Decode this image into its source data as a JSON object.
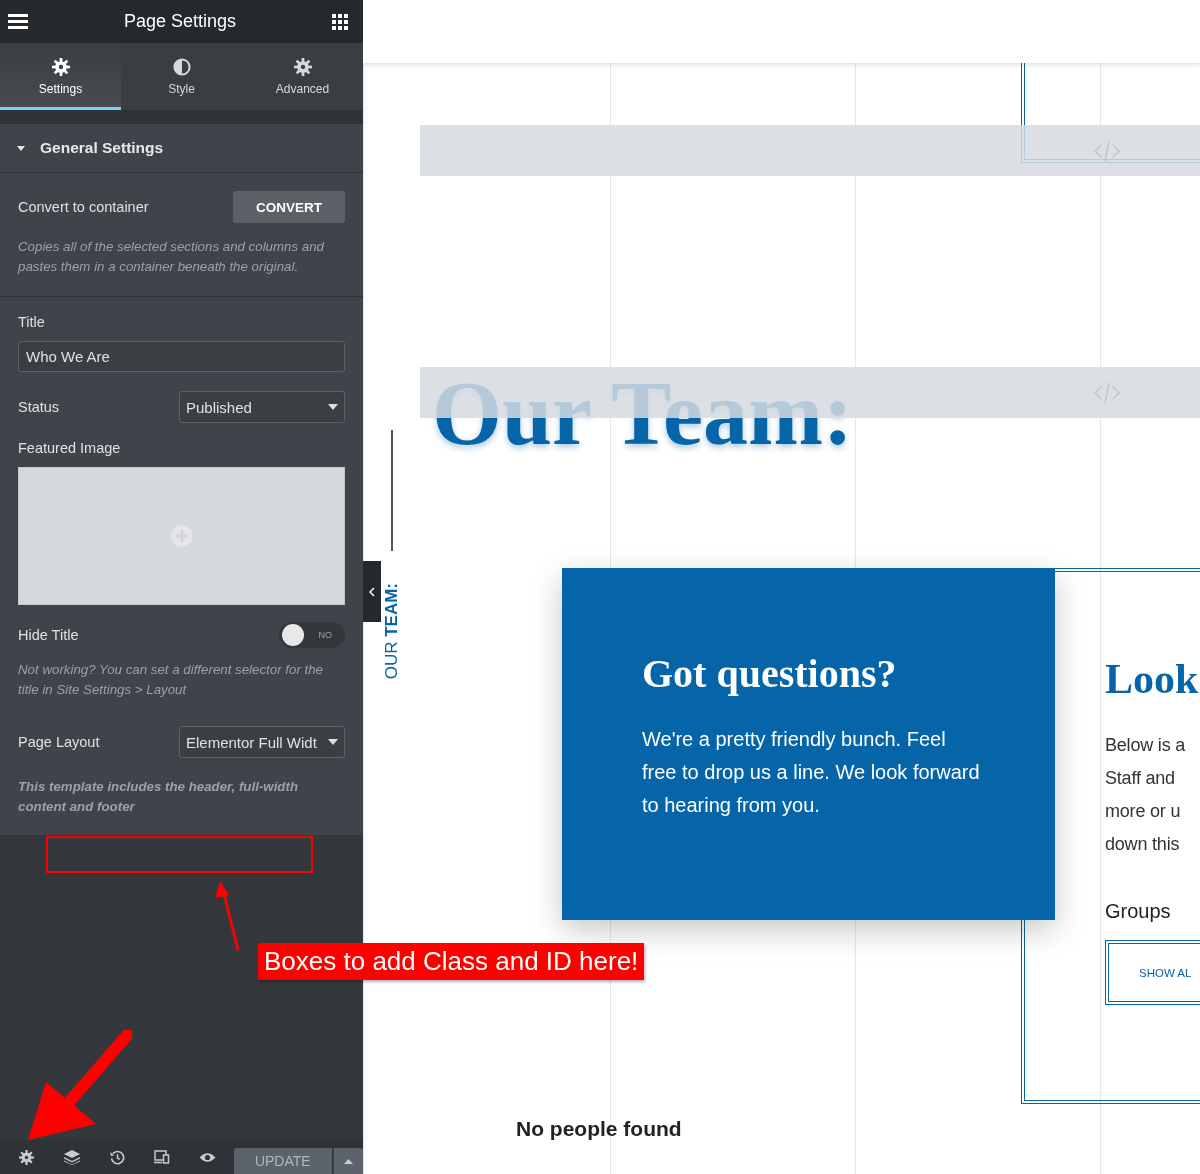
{
  "panel": {
    "title": "Page Settings",
    "tabs": [
      {
        "label": "Settings",
        "selected": true
      },
      {
        "label": "Style",
        "selected": false
      },
      {
        "label": "Advanced",
        "selected": false
      }
    ],
    "section": {
      "title": "General Settings",
      "expanded": true
    },
    "convert": {
      "label": "Convert to container",
      "button": "CONVERT",
      "note": "Copies all of the selected sections and columns and pastes them in a container beneath the original."
    },
    "title_field": {
      "label": "Title",
      "value": "Who We Are"
    },
    "status": {
      "label": "Status",
      "value": "Published"
    },
    "featured_image": {
      "label": "Featured Image"
    },
    "hide_title": {
      "label": "Hide Title",
      "on": false,
      "state_text": "NO",
      "note": "Not working? You can set a different selector for the title in Site Settings > Layout"
    },
    "page_layout": {
      "label": "Page Layout",
      "value": "Elementor Full Widt",
      "note": "This template includes the header, full-width content and footer"
    },
    "footer": {
      "button": "UPDATE"
    }
  },
  "canvas": {
    "heading": "Our Team:",
    "side_label": "OUR **TEAM:**",
    "card": {
      "title": "Got questions?",
      "body": "We're a pretty friendly bunch. Feel free to drop us a line. We look forward to hearing from you."
    },
    "intro": {
      "title": "Look",
      "lines": [
        "Below is a",
        "Staff and",
        "more or u",
        "down this"
      ],
      "groups_label": "Groups",
      "button": "SHOW AL"
    },
    "empty_text": "No people found"
  },
  "annotation": {
    "callout": "Boxes to add Class and ID here!"
  }
}
